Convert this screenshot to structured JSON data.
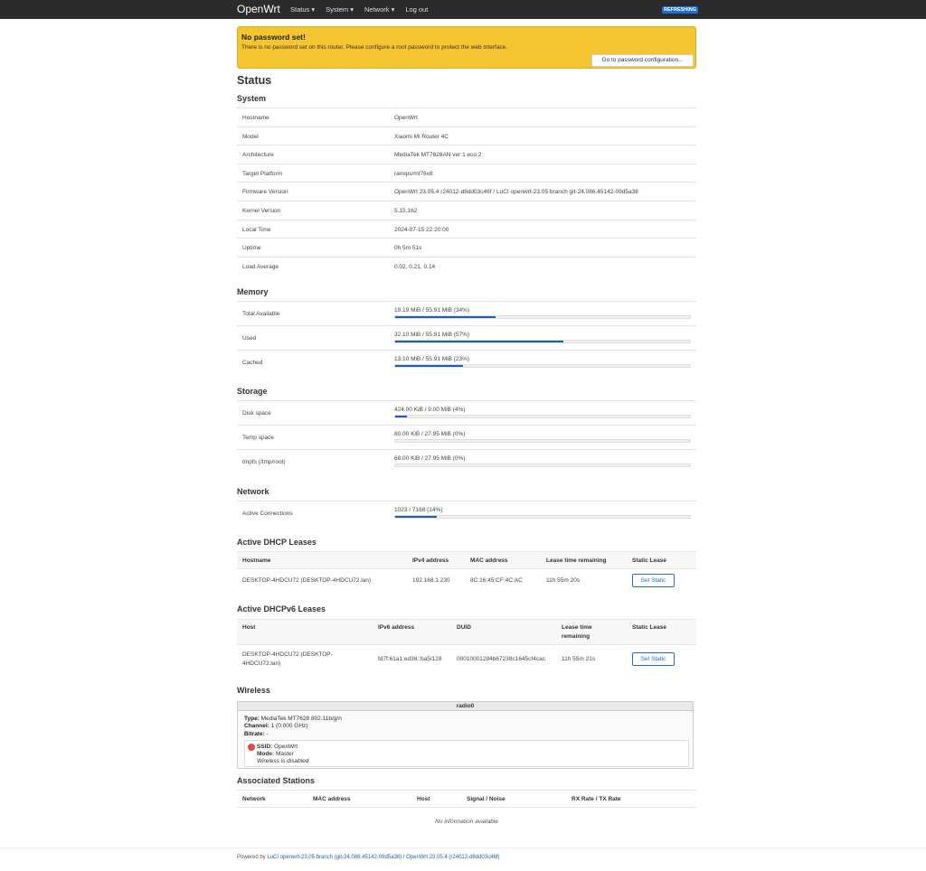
{
  "nav": {
    "brand": "OpenWrt",
    "menu": [
      "Status ▾",
      "System ▾",
      "Network ▾",
      "Log out"
    ],
    "badge": "REFRESHING"
  },
  "alert": {
    "title": "No password set!",
    "text": "There is no password set on this router. Please configure a root password to protect the web interface.",
    "button": "Go to password configuration..."
  },
  "page_title": "Status",
  "system": {
    "heading": "System",
    "rows": [
      {
        "k": "Hostname",
        "v": "OpenWrt"
      },
      {
        "k": "Model",
        "v": "Xiaomi Mi Router 4C"
      },
      {
        "k": "Architecture",
        "v": "MediaTek MT7628AN ver:1 eco:2"
      },
      {
        "k": "Target Platform",
        "v": "ramips/mt76x8"
      },
      {
        "k": "Firmware Version",
        "v": "OpenWrt 23.05.4 r24012-d8dd03c46f / LuCI openwrt-23.05 branch git-24.086.45142-09d5a38"
      },
      {
        "k": "Kernel Version",
        "v": "5.15.162"
      },
      {
        "k": "Local Time",
        "v": "2024-07-15 22:20:00"
      },
      {
        "k": "Uptime",
        "v": "0h 5m 51s"
      },
      {
        "k": "Load Average",
        "v": "0.02, 0.21, 0.14"
      }
    ]
  },
  "memory": {
    "heading": "Memory",
    "rows": [
      {
        "k": "Total Available",
        "v": "19.19 MiB / 55.91 MiB (34%)",
        "pct": 34
      },
      {
        "k": "Used",
        "v": "32.10 MiB / 55.91 MiB (57%)",
        "pct": 57
      },
      {
        "k": "Cached",
        "v": "13.10 MiB / 55.91 MiB (23%)",
        "pct": 23
      }
    ]
  },
  "storage": {
    "heading": "Storage",
    "rows": [
      {
        "k": "Disk space",
        "v": "424.00 KiB / 9.00 MiB (4%)",
        "pct": 4
      },
      {
        "k": "Temp space",
        "v": "80.00 KiB / 27.95 MiB (0%)",
        "pct": 0
      },
      {
        "k": "tmpfs (/tmp/root)",
        "v": "68.00 KiB / 27.95 MiB (0%)",
        "pct": 0
      }
    ]
  },
  "network": {
    "heading": "Network",
    "rows": [
      {
        "k": "Active Connections",
        "v": "1023 / 7168 (14%)",
        "pct": 14
      }
    ]
  },
  "dhcp": {
    "heading": "Active DHCP Leases",
    "columns": [
      "Hostname",
      "IPv4 address",
      "MAC address",
      "Lease time remaining",
      "Static Lease"
    ],
    "rows": [
      {
        "host": "DESKTOP-4HDCU72 (DESKTOP-4HDCU72.lan)",
        "ip": "192.168.1.230",
        "mac": "8C:16:45:CF:4C:AC",
        "lease": "11h 55m 20s",
        "btn": "Set Static"
      }
    ]
  },
  "dhcp6": {
    "heading": "Active DHCPv6 Leases",
    "columns": [
      "Host",
      "IPv6 address",
      "DUID",
      "Lease time",
      "remaining",
      "Static Lease"
    ],
    "rows": [
      {
        "host1": "DESKTOP-4HDCU72 (DESKTOP-",
        "host2": "4HDCU72.lan)",
        "ip": "fd7f:61a1:ed36::ba5/128",
        "duid": "00010001284b67238c1645cf4cac",
        "lease": "11h 55m 21s",
        "btn": "Set Static"
      }
    ]
  },
  "wireless": {
    "heading": "Wireless",
    "radio": "radio0",
    "type_label": "Type:",
    "type_val": "MediaTek MT7628 802.11b/g/n",
    "channel_label": "Channel:",
    "channel_val": "1 (0.000 GHz)",
    "bitrate_label": "Bitrate:",
    "bitrate_val": "-",
    "ssid_label": "SSID:",
    "ssid_val": "OpenWrt",
    "mode_label": "Mode:",
    "mode_val": "Master",
    "state": "Wireless is disabled",
    "status_color": "#e24a4a"
  },
  "stations": {
    "heading": "Associated Stations",
    "columns": [
      "Network",
      "MAC address",
      "Host",
      "Signal / Noise",
      "RX Rate / TX Rate"
    ],
    "empty": "No information available"
  },
  "footer": {
    "prefix": "Powered by ",
    "luci": "LuCI openwrt-23.05 branch (git-24.086.45142-09d5a38)",
    "sep": " / ",
    "os": "OpenWrt 23.05.4 (r24012-d8dd03c46f)"
  }
}
